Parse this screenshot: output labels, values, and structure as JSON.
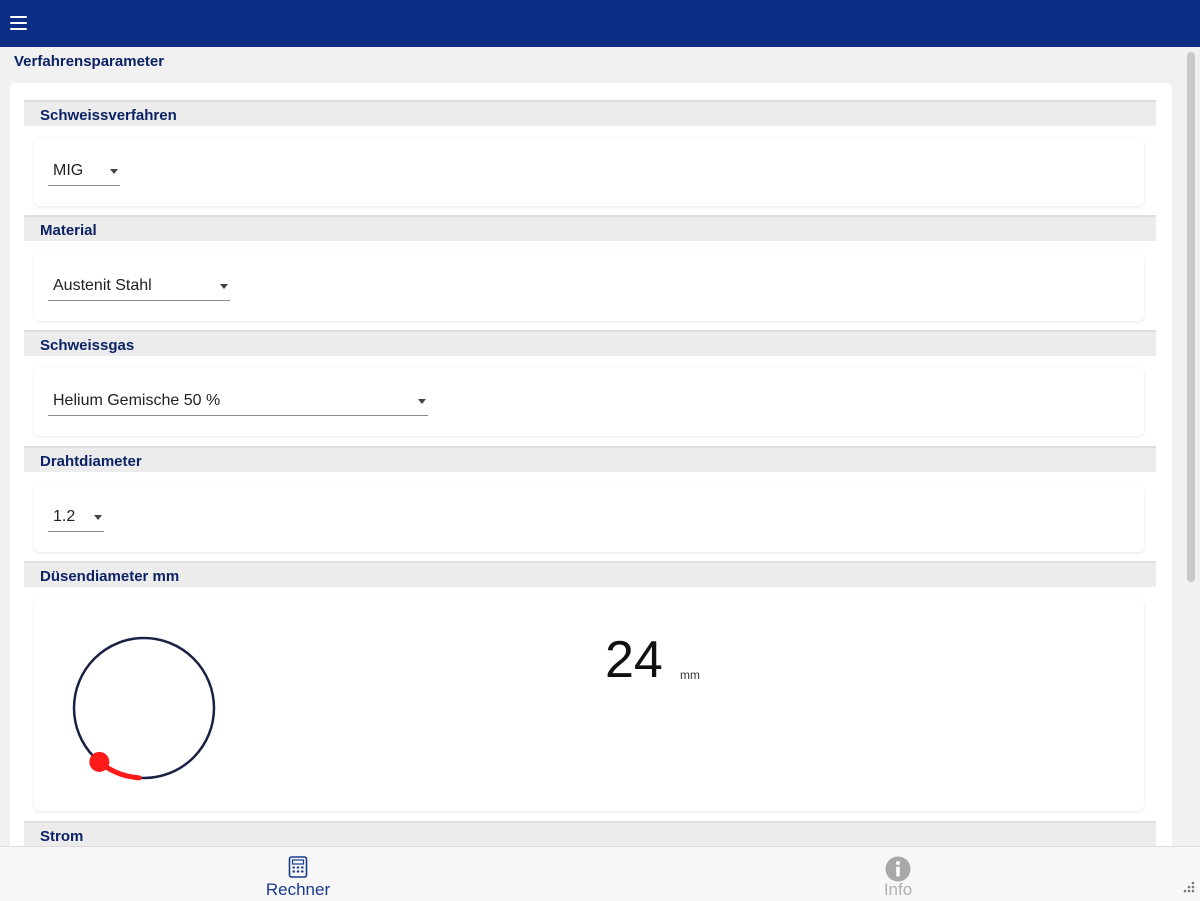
{
  "header": {
    "menu_icon": "hamburger-menu-icon"
  },
  "page": {
    "title": "Verfahrensparameter"
  },
  "sections": {
    "process": {
      "title": "Schweissverfahren",
      "value": "MIG"
    },
    "material": {
      "title": "Material",
      "value": "Austenit Stahl"
    },
    "gas": {
      "title": "Schweissgas",
      "value": "Helium Gemische 50 %"
    },
    "wire": {
      "title": "Drahtdiameter",
      "value": "1.2"
    },
    "nozzle": {
      "title": "Düsendiameter mm",
      "value": "24",
      "unit": "mm",
      "dial_fraction": 0.18
    },
    "current": {
      "title": "Strom"
    }
  },
  "bottom_nav": {
    "tabs": [
      {
        "label": "Rechner",
        "icon": "calculator-icon",
        "active": true
      },
      {
        "label": "Info",
        "icon": "info-icon",
        "active": false
      }
    ]
  },
  "colors": {
    "header_bg": "#0c2d83",
    "accent_text": "#0b2265",
    "dial_ring": "#1b2144",
    "dial_progress": "#ff1a1a"
  }
}
